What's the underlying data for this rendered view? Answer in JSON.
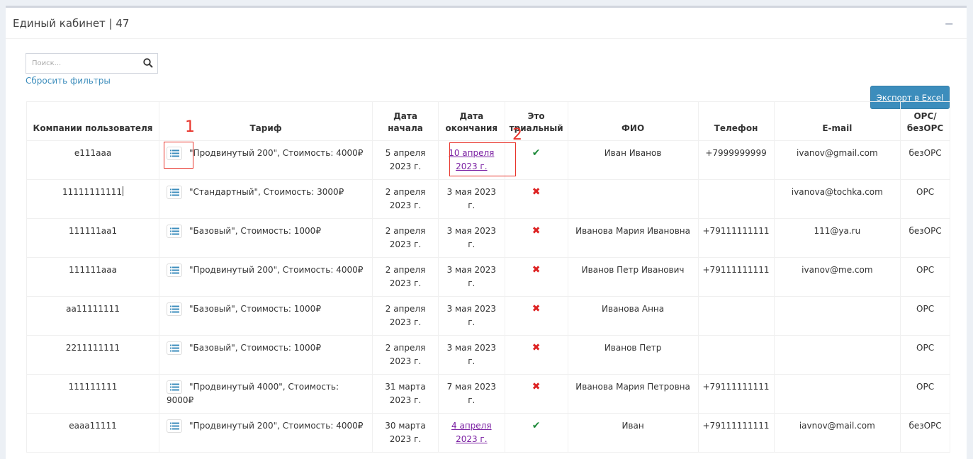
{
  "panel": {
    "title": "Единый кабинет | 47",
    "collapse_icon": "minus-icon"
  },
  "toolbar": {
    "search_placeholder": "Поиск...",
    "search_value": "",
    "reset_filters_label": "Сбросить фильтры",
    "export_label": "Экспорт в Excel"
  },
  "table": {
    "headers": [
      "Компании пользователя",
      "Тариф",
      "Дата начала",
      "Дата окончания",
      "Это триальный",
      "ФИО",
      "Телефон",
      "E-mail",
      "ОРС/ безОРС"
    ],
    "rows": [
      {
        "company": "e111aaa",
        "tariff": "\"Продвинутый 200\", Стоимость: 4000₽",
        "start": "5 апреля 2023 г.",
        "end": "10 апреля 2023 г.",
        "end_link": true,
        "trial": "check",
        "fio": "Иван Иванов",
        "phone": "+7999999999",
        "email": "ivanov@gmail.com",
        "ors": "безОРС"
      },
      {
        "company": "11111111111",
        "tariff": "\"Стандартный\", Стоимость: 3000₽",
        "start": "2 апреля 2023 г.",
        "end": "3 мая 2023 г.",
        "end_link": false,
        "trial": "cross",
        "fio": "",
        "phone": "",
        "email": "ivanova@tochka.com",
        "ors": "ОРС"
      },
      {
        "company": "111111aa1",
        "tariff": "\"Базовый\", Стоимость: 1000₽",
        "start": "2 апреля 2023 г.",
        "end": "3 мая 2023 г.",
        "end_link": false,
        "trial": "cross",
        "fio": "Иванова Мария Ивановна",
        "phone": "+79111111111",
        "email": "111@ya.ru",
        "ors": "безОРС"
      },
      {
        "company": "111111aaa",
        "tariff": "\"Продвинутый 200\", Стоимость: 4000₽",
        "start": "2 апреля 2023 г.",
        "end": "3 мая 2023 г.",
        "end_link": false,
        "trial": "cross",
        "fio": "Иванов Петр Иванович",
        "phone": "+79111111111",
        "email": "ivanov@me.com",
        "ors": "ОРС"
      },
      {
        "company": "aa11111111",
        "tariff": "\"Базовый\", Стоимость: 1000₽",
        "start": "2 апреля 2023 г.",
        "end": "3 мая 2023 г.",
        "end_link": false,
        "trial": "cross",
        "fio": "Иванова Анна",
        "phone": "",
        "email": "",
        "ors": "ОРС"
      },
      {
        "company": "2211111111",
        "tariff": "\"Базовый\", Стоимость: 1000₽",
        "start": "2 апреля 2023 г.",
        "end": "3 мая 2023 г.",
        "end_link": false,
        "trial": "cross",
        "fio": "Иванов Петр",
        "phone": "",
        "email": "",
        "ors": "ОРС"
      },
      {
        "company": "111111111",
        "tariff": "\"Продвинутый 4000\", Стоимость: 9000₽",
        "start": "31 марта 2023 г.",
        "end": "7 мая 2023 г.",
        "end_link": false,
        "trial": "cross",
        "fio": "Иванова Мария Петровна",
        "phone": "+79111111111",
        "email": "",
        "ors": "ОРС"
      },
      {
        "company": "eaaa11111",
        "tariff": "\"Продвинутый 200\", Стоимость: 4000₽",
        "start": "30 марта 2023 г.",
        "end": "4 апреля 2023 г.",
        "end_link": true,
        "trial": "check",
        "fio": "Иван",
        "phone": "+79111111111",
        "email": "iavnov@mail.com",
        "ors": "безОРС"
      }
    ]
  },
  "annotations": {
    "marker_1": "1",
    "marker_2": "2",
    "color": "#e8332a"
  },
  "colors": {
    "accent": "#3c8dbc",
    "link_visited": "#7a1fa2",
    "check": "#1e8a3a",
    "cross": "#dd2222"
  }
}
